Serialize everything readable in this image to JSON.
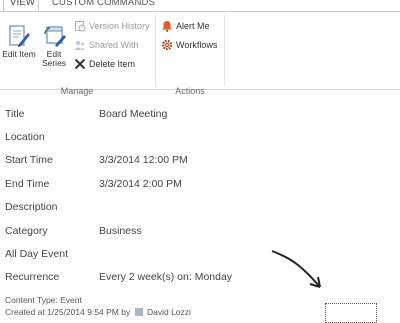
{
  "ribbon_tabs": [
    {
      "label": "VIEW",
      "active": true
    },
    {
      "label": "CUSTOM COMMANDS",
      "active": false
    }
  ],
  "ribbon": {
    "manage": {
      "label": "Manage",
      "edit_item": "Edit Item",
      "edit_series": "Edit Series",
      "version_history": "Version History",
      "shared_with": "Shared With",
      "delete_item": "Delete Item"
    },
    "actions": {
      "label": "Actions",
      "alert_me": "Alert Me",
      "workflows": "Workflows"
    }
  },
  "fields": [
    {
      "label": "Title",
      "value": "Board Meeting"
    },
    {
      "label": "Location",
      "value": ""
    },
    {
      "label": "Start Time",
      "value": "3/3/2014 12:00 PM"
    },
    {
      "label": "End Time",
      "value": "3/3/2014 2:00 PM"
    },
    {
      "label": "Description",
      "value": ""
    },
    {
      "label": "Category",
      "value": "Business"
    },
    {
      "label": "All Day Event",
      "value": ""
    },
    {
      "label": "Recurrence",
      "value": "Every 2 week(s) on: Monday"
    }
  ],
  "footer": {
    "content_type": "Content Type: Event",
    "created_at": "Created at 1/25/2014 9:54 PM by",
    "author": "David Lozzi"
  },
  "colors": {
    "link_blue": "#0072c6",
    "alert_red": "#c0392b"
  }
}
